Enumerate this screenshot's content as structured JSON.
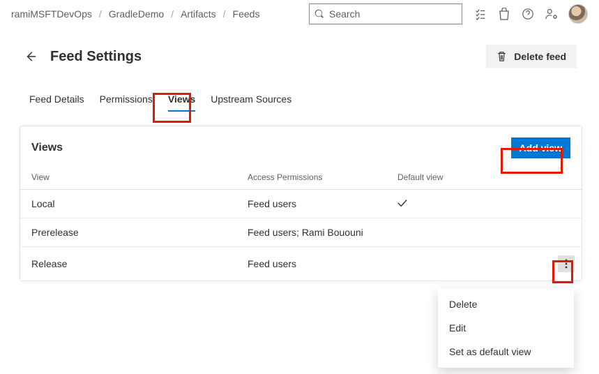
{
  "breadcrumb": [
    "ramiMSFTDevOps",
    "GradleDemo",
    "Artifacts",
    "Feeds"
  ],
  "search": {
    "placeholder": "Search"
  },
  "header": {
    "title": "Feed Settings",
    "delete_label": "Delete feed"
  },
  "tabs": [
    {
      "label": "Feed Details",
      "active": false
    },
    {
      "label": "Permissions",
      "active": false
    },
    {
      "label": "Views",
      "active": true
    },
    {
      "label": "Upstream Sources",
      "active": false
    }
  ],
  "views_card": {
    "title": "Views",
    "add_label": "Add view",
    "columns": [
      "View",
      "Access Permissions",
      "Default view"
    ],
    "rows": [
      {
        "name": "Local",
        "access": "Feed users",
        "default": true
      },
      {
        "name": "Prerelease",
        "access": "Feed users; Rami Bououni",
        "default": false
      },
      {
        "name": "Release",
        "access": "Feed users",
        "default": false,
        "menu_open": true
      }
    ]
  },
  "context_menu": {
    "items": [
      "Delete",
      "Edit",
      "Set as default view"
    ]
  },
  "icons": {
    "back": "arrow-left-icon",
    "search": "search-icon",
    "tasks": "task-list-icon",
    "marketplace": "shopping-bag-icon",
    "help": "help-icon",
    "settings": "user-settings-icon",
    "trash": "trash-icon",
    "more": "more-vertical-icon",
    "check": "checkmark-icon"
  }
}
